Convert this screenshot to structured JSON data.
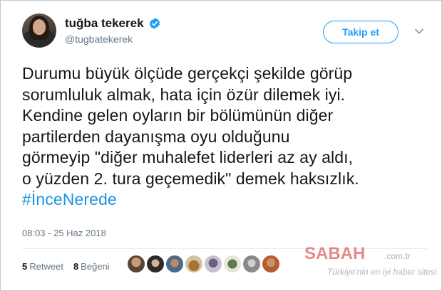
{
  "tweet": {
    "author": {
      "display_name": "tuğba tekerek",
      "handle": "@tugbatekerek",
      "verified_icon": "verified-badge-icon"
    },
    "follow_label": "Takip et",
    "menu_icon": "chevron-down-icon",
    "text_lines": [
      "Durumu büyük ölçüde gerçekçi şekilde görüp",
      "sorumluluk almak, hata için özür dilemek iyi.",
      "Kendine gelen oyların bir bölümünün diğer",
      "partilerden dayanışma oyu olduğunu",
      "görmeyip \"diğer muhalefet liderleri az ay aldı,",
      "o yüzden 2. tura geçemedik\" demek haksızlık."
    ],
    "hashtag": "#İnceNerede",
    "timestamp": "08:03 - 25 Haz 2018",
    "stats": {
      "retweet_count": "5",
      "retweet_label": "Retweet",
      "like_count": "8",
      "like_label": "Beğeni"
    },
    "liker_avatar_count": 8
  },
  "watermark": {
    "logo": "SABAH",
    "domain": ".com.tr",
    "slogan": "Türkiye'nin en iyi haber sitesi"
  },
  "colors": {
    "accent": "#1da1f2",
    "hashtag": "#1b95e0",
    "secondary_text": "#657786",
    "primary_text": "#14171a"
  }
}
